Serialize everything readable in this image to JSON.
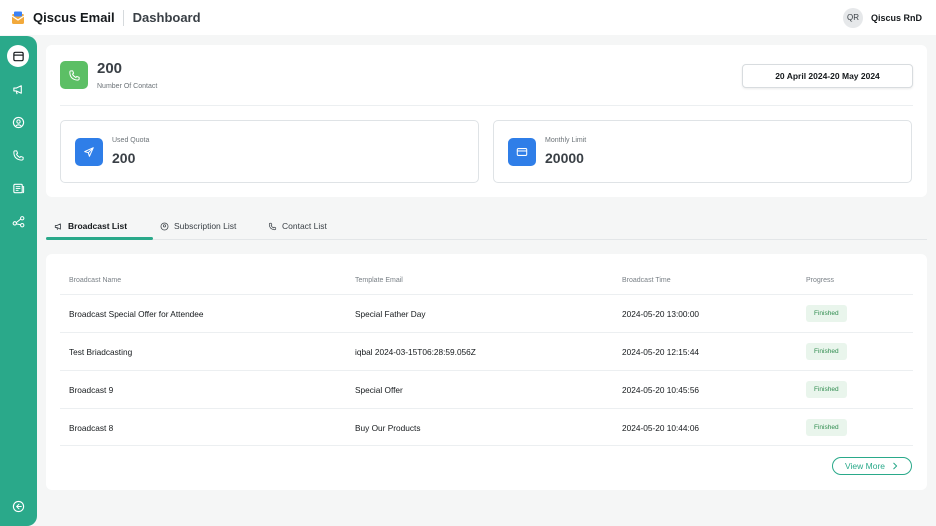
{
  "app": {
    "brand": "Qiscus Email",
    "page_title": "Dashboard"
  },
  "user": {
    "initials": "QR",
    "name": "Qiscus RnD"
  },
  "sidebar": {
    "items": [
      {
        "icon": "dashboard-icon",
        "active": true
      },
      {
        "icon": "megaphone-icon",
        "active": false
      },
      {
        "icon": "user-circle-icon",
        "active": false
      },
      {
        "icon": "phone-icon",
        "active": false
      },
      {
        "icon": "newspaper-icon",
        "active": false
      },
      {
        "icon": "share-icon",
        "active": false
      }
    ],
    "bottom_icon": "collapse-icon"
  },
  "summary": {
    "contact_count": "200",
    "contact_label": "Number Of Contact",
    "date_range": "20 April 2024-20 May 2024",
    "used_quota_label": "Used Quota",
    "used_quota_value": "200",
    "monthly_limit_label": "Monthly Limit",
    "monthly_limit_value": "20000"
  },
  "tabs": [
    {
      "label": "Broadcast List",
      "icon": "megaphone-icon",
      "active": true
    },
    {
      "label": "Subscription List",
      "icon": "user-circle-icon",
      "active": false
    },
    {
      "label": "Contact List",
      "icon": "phone-icon",
      "active": false
    }
  ],
  "table": {
    "headers": [
      "Broadcast Name",
      "Template Email",
      "Broadcast Time",
      "Progress"
    ],
    "rows": [
      {
        "name": "Broadcast Special Offer for Attendee",
        "template": "Special Father Day",
        "time": "2024-05-20 13:00:00",
        "progress": "Finished"
      },
      {
        "name": "Test Briadcasting",
        "template": "iqbal 2024-03-15T06:28:59.056Z",
        "time": "2024-05-20 12:15:44",
        "progress": "Finished"
      },
      {
        "name": "Broadcast 9",
        "template": "Special Offer",
        "time": "2024-05-20 10:45:56",
        "progress": "Finished"
      },
      {
        "name": "Broadcast 8",
        "template": "Buy Our Products",
        "time": "2024-05-20 10:44:06",
        "progress": "Finished"
      }
    ],
    "view_more": "View More"
  },
  "colors": {
    "accent": "#2aa98a",
    "contact_icon_bg": "#5cbf65",
    "quota_icon_bg": "#2f7ee8",
    "badge_bg": "#e9f5ec",
    "badge_text": "#2e8b4e"
  }
}
